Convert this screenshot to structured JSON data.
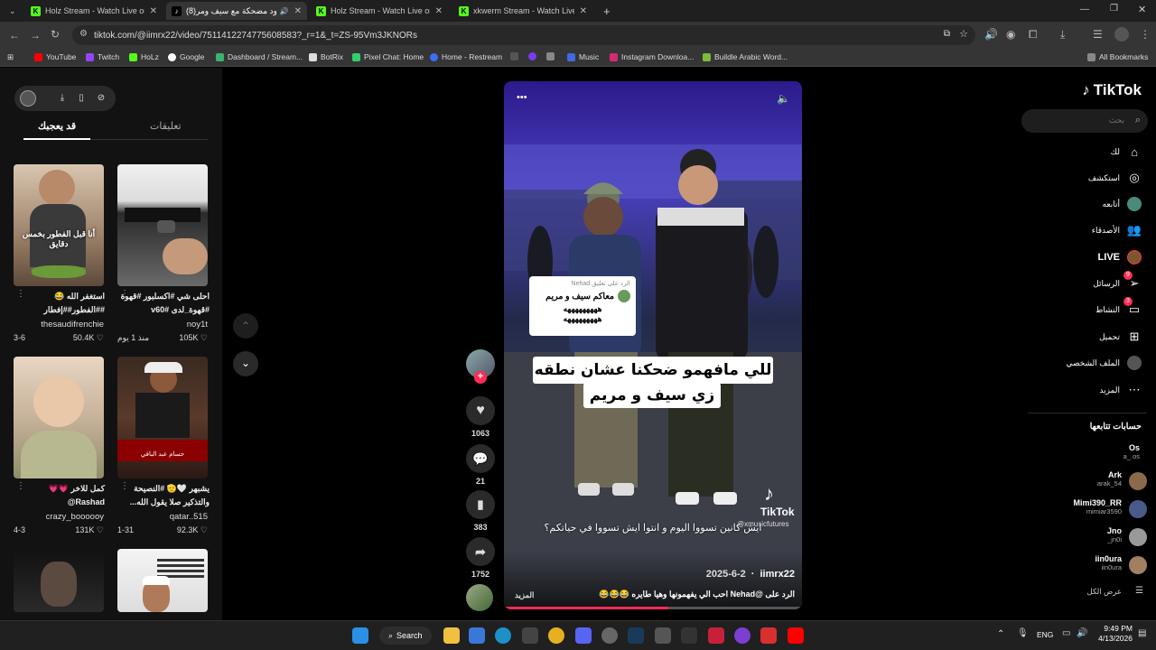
{
  "browser": {
    "tabs": [
      {
        "title": "Holz Stream - Watch Live on Ki",
        "active": false
      },
      {
        "title": "ردود مضحكة مع سيف ومر(8)",
        "active": true
      },
      {
        "title": "Holz Stream - Watch Live on Ki",
        "active": false
      },
      {
        "title": "xkwerm Stream - Watch Live on",
        "active": false
      }
    ],
    "new_tab": "+",
    "url": "tiktok.com/@iimrx22/video/7511412274775608583?_r=1&_t=ZS-95Vm3JKNORs",
    "bookmarks": [
      "YouTube",
      "Twitch",
      "HoLz",
      "Google",
      "Dashboard / Stream...",
      "BotRix",
      "Pixel Chat: Home",
      "Home - Restream",
      "Music",
      "Instagram Downloa...",
      "Buildle Arabic Word..."
    ],
    "all_bookmarks": "All Bookmarks"
  },
  "left_panel": {
    "tab_liked": "قد يعجبك",
    "tab_comments": "تعليقات",
    "cards": [
      {
        "overlay": "أنا قبل الفطور بخمس دقايق",
        "caption": "استغفر الله 😂 ##الفطور##إفطار",
        "author": "thesaudifrenchie",
        "likes": "50.4K",
        "date": "3-6"
      },
      {
        "overlay": "",
        "caption": "احلى شي #اكسلبور #قهوة #قهوة_لدى #v60",
        "author": "noy1t",
        "likes": "105K",
        "date": "منذ 1 يوم"
      },
      {
        "overlay": "",
        "caption": "كمل للاخر 💗💗 Rashad@",
        "author": "crazy_boooooy",
        "likes": "131K",
        "date": "4-3"
      },
      {
        "overlay": "حسام عبد الباقي",
        "caption": "يشبهر 🤍🫡 #النصيحة والتذكير صلا يقول الله...",
        "author": "qatar..515",
        "likes": "92.3K",
        "date": "1-31"
      },
      {
        "overlay": "",
        "caption": "",
        "author": "",
        "likes": "",
        "date": ""
      },
      {
        "overlay": "",
        "caption": "",
        "author": "",
        "likes": "",
        "date": ""
      }
    ]
  },
  "video": {
    "reply_label": "الرد على تعليق Nehad",
    "reply_text": "معاكم سيف و مريم",
    "reply_laugh": "هههههههههه",
    "caption_line1": "للي مافهمو ضحكنا عشان نطقه",
    "caption_line2": "زي سيف و مريم",
    "bottom_question": "ايش كانين تسووا اليوم و انتوا ايش تسووا في حياتكم؟",
    "watermark": "TikTok",
    "watermark_handle": "@xmusicfutures",
    "date": "2025-6-2",
    "author": "iimrx22",
    "description": "الرد على @Nehad احب الي يفهمونها وهيا طايره 😂😂😂",
    "more": "المزيد",
    "likes": "1063",
    "comments": "21",
    "saves": "383",
    "shares": "1752"
  },
  "right_nav": {
    "logo": "TikTok",
    "search_placeholder": "بحث",
    "items": [
      {
        "label": "لك",
        "icon": "home-icon"
      },
      {
        "label": "استكشف",
        "icon": "compass-icon"
      },
      {
        "label": "أتابعه",
        "icon": "following-icon"
      },
      {
        "label": "الأصدقاء",
        "icon": "friends-icon"
      },
      {
        "label": "LIVE",
        "icon": "live-icon"
      },
      {
        "label": "الرسائل",
        "icon": "messages-icon",
        "badge": "9"
      },
      {
        "label": "النشاط",
        "icon": "activity-icon",
        "badge": "3"
      },
      {
        "label": "تحميل",
        "icon": "upload-icon"
      },
      {
        "label": "الملف الشخصي",
        "icon": "profile-icon"
      },
      {
        "label": "المزيد",
        "icon": "more-icon"
      }
    ],
    "following_title": "حسابات تتابعها",
    "following": [
      {
        "name": "Os",
        "handle": "a_.os"
      },
      {
        "name": "Ark",
        "handle": "arak_54"
      },
      {
        "name": "Mimi390_RR",
        "handle": "mimiar3590"
      },
      {
        "name": "Jno",
        "handle": "_jn0i"
      },
      {
        "name": "iin0ura",
        "handle": "iin0ura"
      }
    ],
    "show_all": "عرض الكل"
  },
  "taskbar": {
    "search": "Search",
    "lang": "ENG",
    "time": "9:49 PM",
    "date": "4/13/2026"
  }
}
